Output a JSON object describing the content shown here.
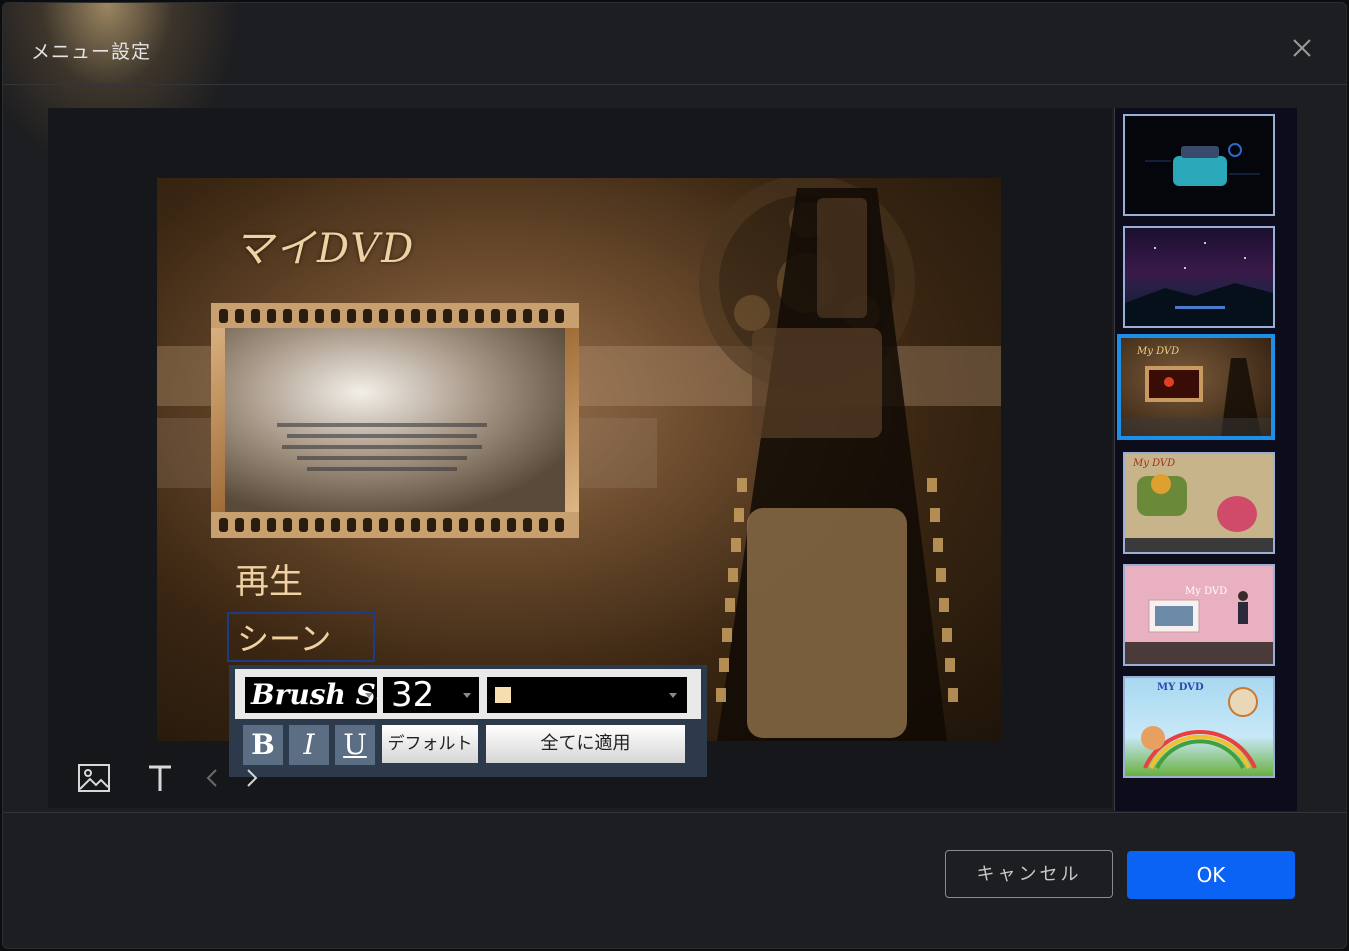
{
  "dialog": {
    "title": "メニュー設定",
    "close_icon": "close-icon"
  },
  "preview": {
    "menu_title": "マイDVD",
    "play_label": "再生",
    "scene_label": "シーン"
  },
  "format_toolbar": {
    "font": "Brush Script",
    "size": "32",
    "color": "#f7deb0",
    "bold_label": "B",
    "italic_label": "I",
    "underline_label": "U",
    "default_label": "デフォルト",
    "apply_all_label": "全てに適用"
  },
  "tools": {
    "image_icon": "image-icon",
    "text_icon": "text-icon",
    "prev_icon": "chevron-left-icon",
    "next_icon": "chevron-right-icon"
  },
  "templates": [
    {
      "name": "template-tech",
      "selected": false
    },
    {
      "name": "template-night-sky",
      "selected": false
    },
    {
      "name": "template-film",
      "selected": true,
      "label": "My DVD"
    },
    {
      "name": "template-birthday",
      "selected": false,
      "label": "My DVD"
    },
    {
      "name": "template-wedding",
      "selected": false,
      "label": "My DVD"
    },
    {
      "name": "template-kids",
      "selected": false,
      "label": "MY DVD"
    }
  ],
  "footer": {
    "cancel_label": "キャンセル",
    "ok_label": "OK"
  }
}
